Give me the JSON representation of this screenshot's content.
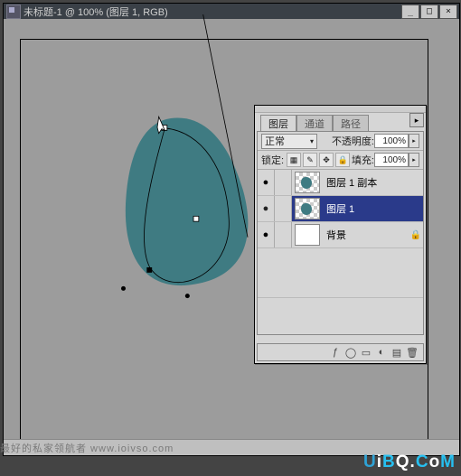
{
  "window": {
    "title": "未标题-1 @ 100% (图层 1, RGB)",
    "min": "_",
    "max": "□",
    "close": "×"
  },
  "panel": {
    "tabs": {
      "layers": "图层",
      "channels": "通道",
      "paths": "路径"
    },
    "menu_close": "▸",
    "blend_label": "正常",
    "opacity_label": "不透明度:",
    "opacity_value": "100%",
    "lock_label": "锁定:",
    "fill_label": "填充:",
    "fill_value": "100%",
    "icons": {
      "lock_trans": "▦",
      "lock_brush": "✎",
      "lock_move": "✥",
      "lock_all": "🔒"
    },
    "layers": [
      {
        "name": "图层 1 副本",
        "visible": "●",
        "selected": false,
        "has_shape": true,
        "locked": ""
      },
      {
        "name": "图层 1",
        "visible": "●",
        "selected": true,
        "has_shape": true,
        "locked": ""
      },
      {
        "name": "背景",
        "visible": "●",
        "selected": false,
        "has_shape": false,
        "locked": "🔒"
      }
    ],
    "footer": {
      "fx": "ƒ",
      "mask": "◯",
      "folder": "▭",
      "adjust": "◐",
      "new": "▤",
      "trash": "🗑"
    }
  },
  "watermark": "最好的私家领航者 www.ioivso.com",
  "brand": {
    "full": "UiBQ.CoM"
  },
  "colors": {
    "shape": "#3f7b82",
    "selection": "#2a3a8a"
  }
}
